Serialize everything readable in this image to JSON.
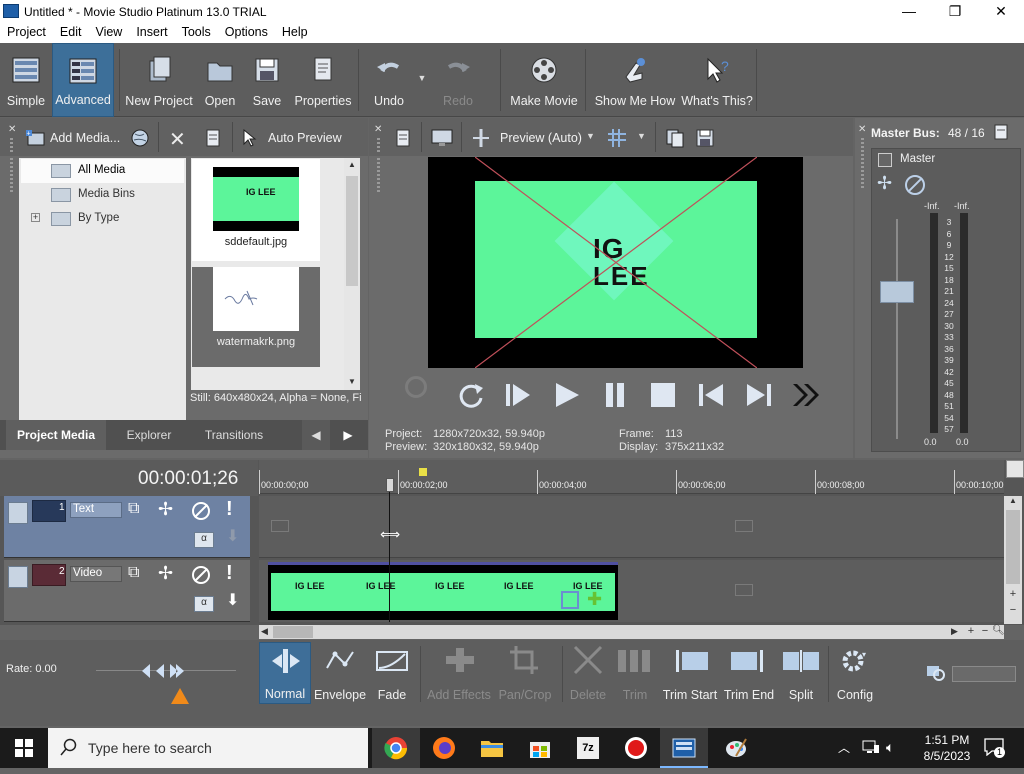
{
  "window": {
    "title": "Untitled * - Movie Studio Platinum 13.0 TRIAL",
    "minimize": "—",
    "maximize": "❐",
    "close": "✕"
  },
  "menu": [
    "Project",
    "Edit",
    "View",
    "Insert",
    "Tools",
    "Options",
    "Help"
  ],
  "toolbar": {
    "simple": "Simple",
    "advanced": "Advanced",
    "new_project": "New Project",
    "open": "Open",
    "save": "Save",
    "properties": "Properties",
    "undo": "Undo",
    "redo": "Redo",
    "make_movie": "Make Movie",
    "show_me_how": "Show Me How",
    "whats_this": "What's This?"
  },
  "media_panel": {
    "add_media": "Add Media...",
    "auto_preview": "Auto Preview",
    "tree": [
      "All Media",
      "Media Bins",
      "By Type"
    ],
    "tree_expander": "+",
    "files": [
      {
        "name": "sddefault.jpg"
      },
      {
        "name": "watermakrk.png"
      }
    ],
    "thumb_text": "IG LEE",
    "status": "Still: 640x480x24, Alpha = None, Fi",
    "tabs": [
      "Project Media",
      "Explorer",
      "Transitions"
    ]
  },
  "preview": {
    "mode": "Preview (Auto)",
    "image_text_top": "IG",
    "image_text_bottom": "LEE",
    "project_label": "Project:",
    "project_value": "1280x720x32, 59.940p",
    "preview_label": "Preview:",
    "preview_value": "320x180x32, 59.940p",
    "frame_label": "Frame:",
    "frame_value": "113",
    "display_label": "Display:",
    "display_value": "375x211x32"
  },
  "master": {
    "title": "Master Bus:",
    "value": "48 / 16",
    "label": "Master",
    "inf_left": "-Inf.",
    "inf_right": "-Inf.",
    "scale": [
      "3",
      "6",
      "9",
      "12",
      "15",
      "18",
      "21",
      "24",
      "27",
      "30",
      "33",
      "36",
      "39",
      "42",
      "45",
      "48",
      "51",
      "54",
      "57"
    ],
    "bottom_left": "0.0",
    "bottom_right": "0.0"
  },
  "timeline": {
    "timecode": "00:00:01;26",
    "ruler": [
      "00:00:00;00",
      "00:00:02;00",
      "00:00:04;00",
      "00:00:06;00",
      "00:00:08;00",
      "00:00:10;00"
    ],
    "tracks": [
      {
        "num": "1",
        "name": "Text"
      },
      {
        "num": "2",
        "name": "Video"
      }
    ],
    "rate": "Rate: 0.00"
  },
  "edit_tools": {
    "normal": "Normal",
    "envelope": "Envelope",
    "fade": "Fade",
    "add_effects": "Add Effects",
    "pan_crop": "Pan/Crop",
    "delete": "Delete",
    "trim": "Trim",
    "trim_start": "Trim Start",
    "trim_end": "Trim End",
    "split": "Split",
    "config": "Config"
  },
  "taskbar": {
    "search": "Type here to search",
    "time": "1:51 PM",
    "date": "8/5/2023",
    "notif": "1"
  },
  "colors": {
    "accent_green": "#5cf59a",
    "selected_tool": "#3f6f9a"
  }
}
